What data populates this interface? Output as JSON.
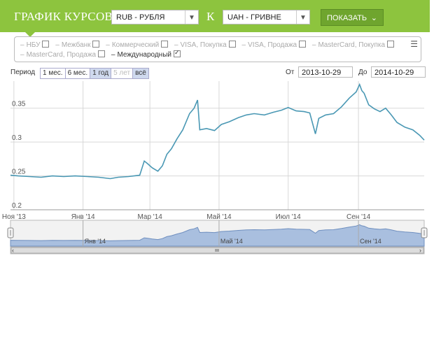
{
  "header": {
    "title": "ГРАФИК КУРСОВ",
    "from_currency": "RUB - РУБЛЯ",
    "to_label": "К",
    "to_currency": "UAH - ГРИВНЕ",
    "show_button": "ПОКАЗАТЬ",
    "accent_color": "#8dc43e"
  },
  "filters": {
    "items": [
      {
        "label": "НБУ",
        "checked": false
      },
      {
        "label": "Межбанк",
        "checked": false
      },
      {
        "label": "Коммерческий",
        "checked": false
      },
      {
        "label": "VISA, Покупка",
        "checked": false
      },
      {
        "label": "VISA, Продажа",
        "checked": false
      },
      {
        "label": "MasterCard, Покупка",
        "checked": false
      },
      {
        "label": "MasterCard, Продажа",
        "checked": false
      },
      {
        "label": "Международный",
        "checked": true
      }
    ],
    "menu_icon": "hamburger-icon"
  },
  "toolbar": {
    "period_label": "Период",
    "periods": [
      "1 мес.",
      "6 мес.",
      "1 год",
      "5 лет",
      "всё"
    ],
    "selected_period": "1 год",
    "from_label": "От",
    "from_date": "2013-10-29",
    "to_label": "До",
    "to_date": "2014-10-29"
  },
  "chart_data": {
    "type": "line",
    "title": "",
    "xlabel": "",
    "ylabel": "",
    "x_ticks": [
      "Ноя '13",
      "Янв '14",
      "Мар '14",
      "Май '14",
      "Июл '14",
      "Сен '14"
    ],
    "y_ticks": [
      "0.2",
      "0.25",
      "0.3",
      "0.35"
    ],
    "ylim": [
      0.2,
      0.39
    ],
    "line_color": "#4a98b4",
    "series": [
      {
        "values": [
          [
            "2013-10-29",
            0.251
          ],
          [
            "2013-11-05",
            0.25
          ],
          [
            "2013-11-15",
            0.249
          ],
          [
            "2013-11-25",
            0.248
          ],
          [
            "2013-12-05",
            0.25
          ],
          [
            "2013-12-15",
            0.249
          ],
          [
            "2013-12-25",
            0.25
          ],
          [
            "2014-01-05",
            0.249
          ],
          [
            "2014-01-15",
            0.248
          ],
          [
            "2014-01-25",
            0.246
          ],
          [
            "2014-02-01",
            0.248
          ],
          [
            "2014-02-10",
            0.249
          ],
          [
            "2014-02-20",
            0.251
          ],
          [
            "2014-02-24",
            0.272
          ],
          [
            "2014-02-27",
            0.268
          ],
          [
            "2014-03-03",
            0.262
          ],
          [
            "2014-03-08",
            0.257
          ],
          [
            "2014-03-12",
            0.265
          ],
          [
            "2014-03-16",
            0.282
          ],
          [
            "2014-03-20",
            0.29
          ],
          [
            "2014-03-25",
            0.305
          ],
          [
            "2014-03-30",
            0.318
          ],
          [
            "2014-04-05",
            0.342
          ],
          [
            "2014-04-09",
            0.35
          ],
          [
            "2014-04-12",
            0.362
          ],
          [
            "2014-04-14",
            0.318
          ],
          [
            "2014-04-20",
            0.32
          ],
          [
            "2014-04-27",
            0.317
          ],
          [
            "2014-05-03",
            0.326
          ],
          [
            "2014-05-10",
            0.33
          ],
          [
            "2014-05-18",
            0.336
          ],
          [
            "2014-05-25",
            0.34
          ],
          [
            "2014-06-01",
            0.342
          ],
          [
            "2014-06-10",
            0.34
          ],
          [
            "2014-06-18",
            0.344
          ],
          [
            "2014-06-25",
            0.347
          ],
          [
            "2014-07-01",
            0.351
          ],
          [
            "2014-07-08",
            0.346
          ],
          [
            "2014-07-15",
            0.345
          ],
          [
            "2014-07-20",
            0.343
          ],
          [
            "2014-07-25",
            0.312
          ],
          [
            "2014-07-28",
            0.335
          ],
          [
            "2014-08-03",
            0.34
          ],
          [
            "2014-08-10",
            0.342
          ],
          [
            "2014-08-17",
            0.352
          ],
          [
            "2014-08-24",
            0.365
          ],
          [
            "2014-08-30",
            0.374
          ],
          [
            "2014-09-02",
            0.385
          ],
          [
            "2014-09-04",
            0.376
          ],
          [
            "2014-09-06",
            0.372
          ],
          [
            "2014-09-10",
            0.355
          ],
          [
            "2014-09-15",
            0.349
          ],
          [
            "2014-09-20",
            0.345
          ],
          [
            "2014-09-25",
            0.35
          ],
          [
            "2014-09-30",
            0.34
          ],
          [
            "2014-10-05",
            0.329
          ],
          [
            "2014-10-12",
            0.322
          ],
          [
            "2014-10-19",
            0.318
          ],
          [
            "2014-10-25",
            0.31
          ],
          [
            "2014-10-29",
            0.303
          ]
        ]
      }
    ],
    "navigator": {
      "x_ticks": [
        "Янв '14",
        "Май '14",
        "Сен '14"
      ],
      "fill_color": "#a9bfdf"
    }
  }
}
